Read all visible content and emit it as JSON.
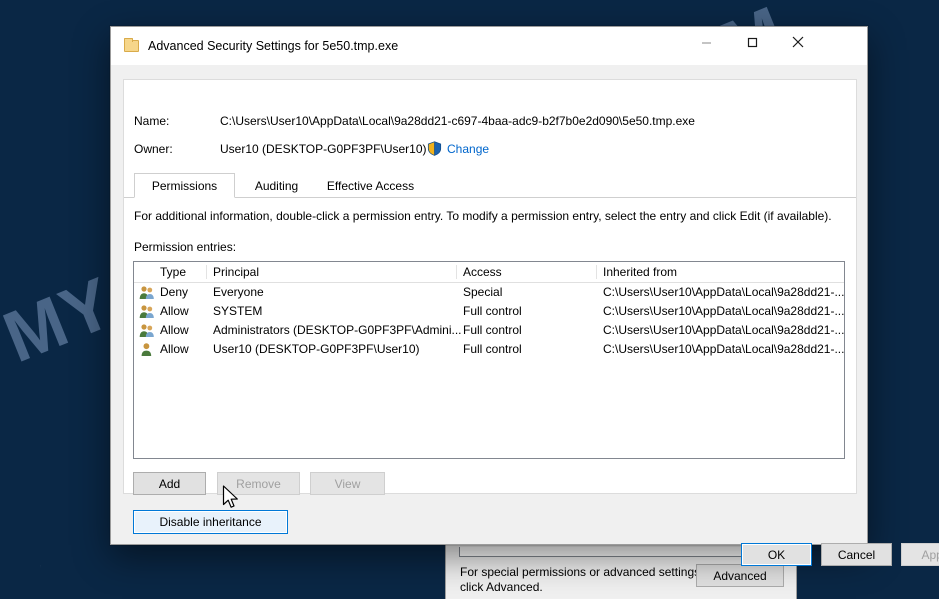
{
  "window": {
    "title": "Advanced Security Settings for 5e50.tmp.exe",
    "icon": "folder-icon",
    "minimize_label": "Minimize",
    "maximize_label": "Maximize",
    "close_label": "Close"
  },
  "header": {
    "name_label": "Name:",
    "name_value": "C:\\Users\\User10\\AppData\\Local\\9a28dd21-c697-4baa-adc9-b2f7b0e2d090\\5e50.tmp.exe",
    "owner_label": "Owner:",
    "owner_value": "User10 (DESKTOP-G0PF3PF\\User10)",
    "change_link": "Change",
    "change_icon": "uac-shield-icon"
  },
  "tabs": [
    {
      "label": "Permissions",
      "selected": true
    },
    {
      "label": "Auditing",
      "selected": false
    },
    {
      "label": "Effective Access",
      "selected": false
    }
  ],
  "main": {
    "info_text": "For additional information, double-click a permission entry. To modify a permission entry, select the entry and click Edit (if available).",
    "entries_label": "Permission entries:"
  },
  "table": {
    "columns": [
      "Type",
      "Principal",
      "Access",
      "Inherited from"
    ],
    "rows": [
      {
        "icon": "group-icon",
        "type": "Deny",
        "principal": "Everyone",
        "access": "Special",
        "inherited_from": "C:\\Users\\User10\\AppData\\Local\\9a28dd21-..."
      },
      {
        "icon": "group-icon",
        "type": "Allow",
        "principal": "SYSTEM",
        "access": "Full control",
        "inherited_from": "C:\\Users\\User10\\AppData\\Local\\9a28dd21-..."
      },
      {
        "icon": "group-icon",
        "type": "Allow",
        "principal": "Administrators (DESKTOP-G0PF3PF\\Admini...",
        "access": "Full control",
        "inherited_from": "C:\\Users\\User10\\AppData\\Local\\9a28dd21-..."
      },
      {
        "icon": "user-icon",
        "type": "Allow",
        "principal": "User10 (DESKTOP-G0PF3PF\\User10)",
        "access": "Full control",
        "inherited_from": "C:\\Users\\User10\\AppData\\Local\\9a28dd21-..."
      }
    ]
  },
  "actions": {
    "add": "Add",
    "remove": "Remove",
    "view": "View",
    "disable_inheritance": "Disable inheritance"
  },
  "footer": {
    "ok": "OK",
    "cancel": "Cancel",
    "apply": "Apply"
  },
  "background_dialog": {
    "hint_line1": "For special permissions or advanced settings,",
    "hint_line2": "click Advanced.",
    "advanced_button": "Advanced"
  },
  "watermark": {
    "text": "MYANTISPYWARE.COM"
  },
  "colors": {
    "accent": "#0078d7",
    "link": "#0066cc",
    "dialog_bg": "#f0f0f0",
    "desktop": "#0b2341"
  }
}
